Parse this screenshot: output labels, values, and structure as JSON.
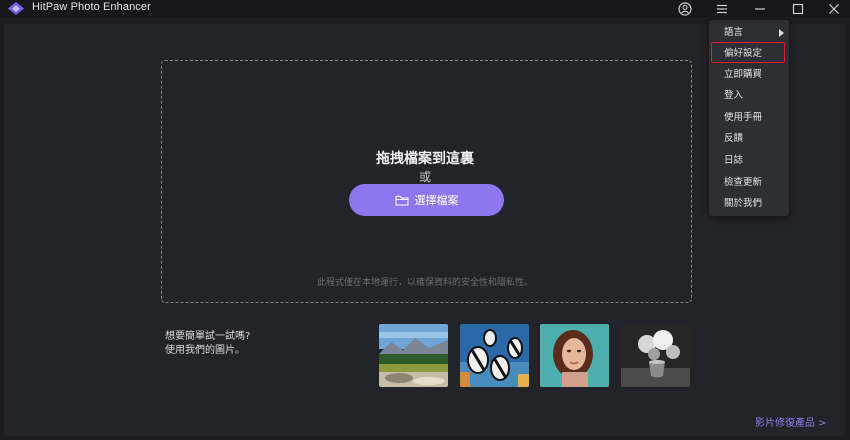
{
  "window": {
    "title": "HitPaw Photo Enhancer",
    "logo_icon": "hitpaw-logo-icon",
    "controls": [
      "account-icon",
      "menu-icon",
      "minimize-icon",
      "maximize-icon",
      "close-icon"
    ]
  },
  "dropzone": {
    "title": "拖拽檔案到這裏",
    "or_text": "或",
    "button_label": "選擇檔案",
    "button_icon": "folder-icon",
    "note": "此程式僅在本地運行，以確保資料的安全性和隱私性。"
  },
  "samples": {
    "line1": "想要簡單試一試嗎?",
    "line2": "使用我們的圖片。",
    "images": [
      "landscape-sample",
      "fish-sample",
      "portrait-sample",
      "flower-vase-sample"
    ]
  },
  "footer": {
    "video_link": "影片修復產品 >"
  },
  "menu": {
    "items": [
      {
        "label": "語言",
        "submenu": true
      },
      {
        "label": "偏好設定",
        "highlighted": true
      },
      {
        "label": "立即購買"
      },
      {
        "label": "登入"
      },
      {
        "label": "使用手冊"
      },
      {
        "label": "反饋"
      },
      {
        "label": "日誌"
      },
      {
        "label": "檢查更新"
      },
      {
        "label": "關於我們"
      }
    ]
  },
  "colors": {
    "accent": "#8e76f1",
    "highlight_border": "#e01d1d",
    "background": "#23232a"
  }
}
